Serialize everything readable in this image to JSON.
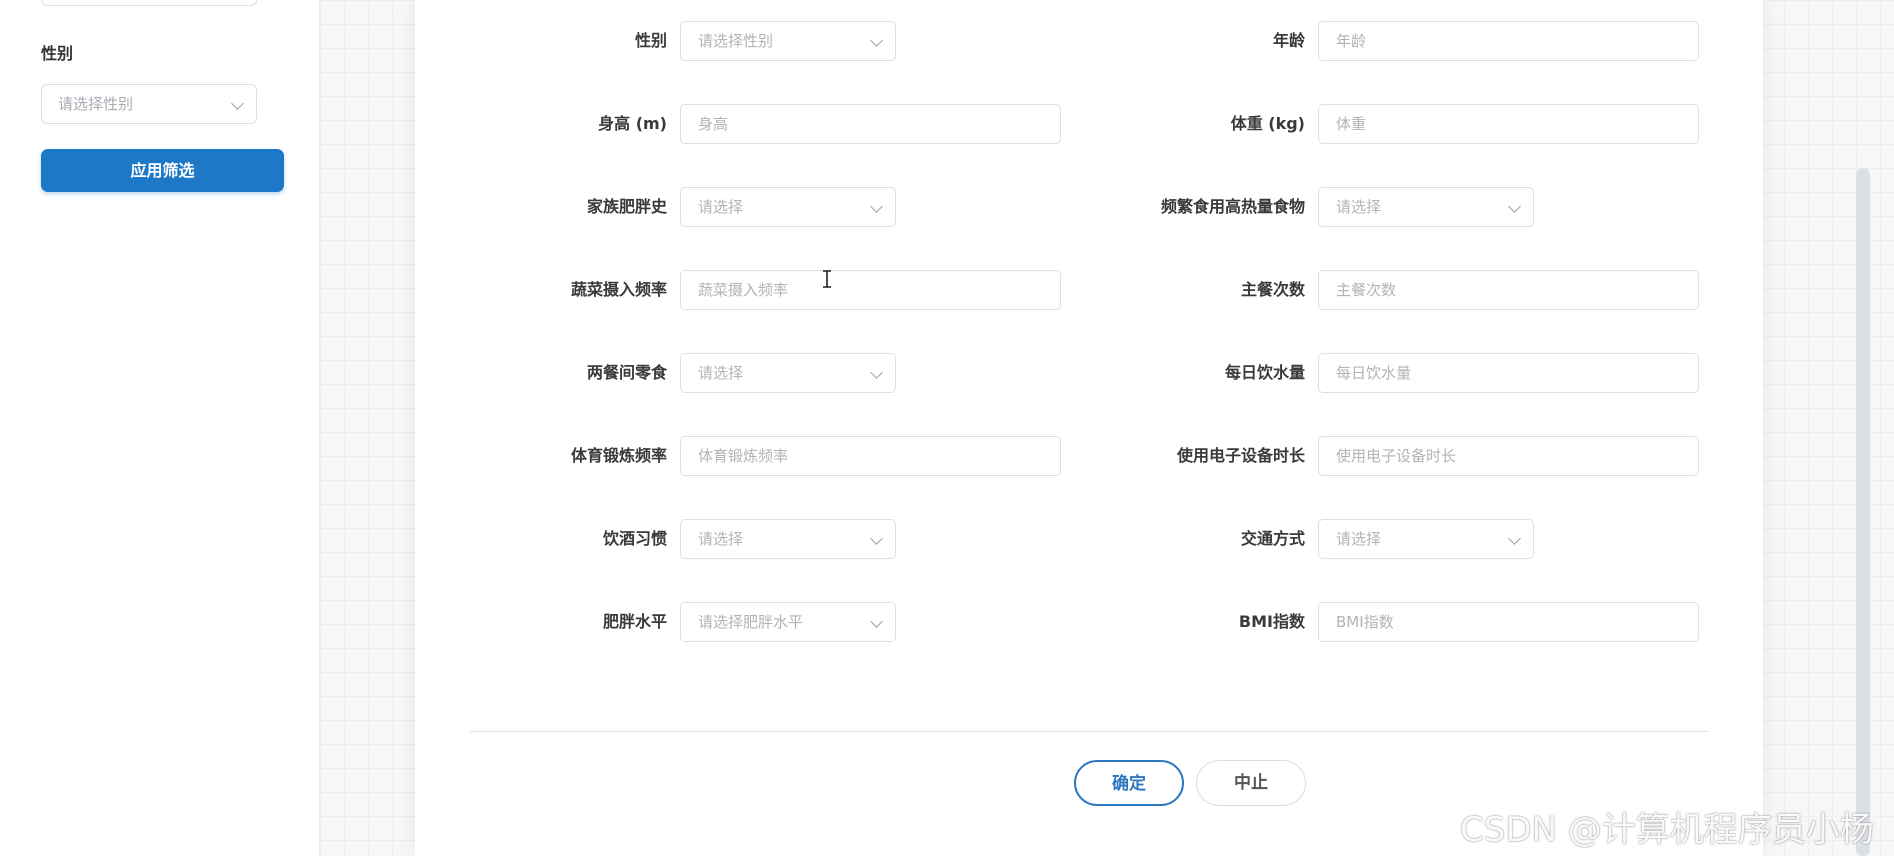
{
  "sidebar": {
    "gender_label": "性别",
    "gender_placeholder": "请选择性别",
    "apply_button": "应用筛选"
  },
  "form": {
    "gender": {
      "label": "性别",
      "placeholder": "请选择性别"
    },
    "age": {
      "label": "年龄",
      "placeholder": "年龄"
    },
    "height": {
      "label": "身高 (m)",
      "placeholder": "身高"
    },
    "weight": {
      "label": "体重 (kg)",
      "placeholder": "体重"
    },
    "family_history": {
      "label": "家族肥胖史",
      "placeholder": "请选择"
    },
    "high_calorie": {
      "label": "频繁食用高热量食物",
      "placeholder": "请选择"
    },
    "vegetable_freq": {
      "label": "蔬菜摄入频率",
      "placeholder": "蔬菜摄入频率"
    },
    "main_meals": {
      "label": "主餐次数",
      "placeholder": "主餐次数"
    },
    "snacks": {
      "label": "两餐间零食",
      "placeholder": "请选择"
    },
    "water": {
      "label": "每日饮水量",
      "placeholder": "每日饮水量"
    },
    "exercise": {
      "label": "体育锻炼频率",
      "placeholder": "体育锻炼频率"
    },
    "device_time": {
      "label": "使用电子设备时长",
      "placeholder": "使用电子设备时长"
    },
    "alcohol": {
      "label": "饮酒习惯",
      "placeholder": "请选择"
    },
    "transport": {
      "label": "交通方式",
      "placeholder": "请选择"
    },
    "obesity_level": {
      "label": "肥胖水平",
      "placeholder": "请选择肥胖水平"
    },
    "bmi": {
      "label": "BMI指数",
      "placeholder": "BMI指数"
    }
  },
  "footer": {
    "confirm": "确定",
    "cancel": "中止"
  },
  "watermark": "CSDN @计算机程序员小杨",
  "colors": {
    "primary": "#1e78c8",
    "confirm_border": "#2c77c0",
    "accent_top": "#3ccf8e"
  }
}
